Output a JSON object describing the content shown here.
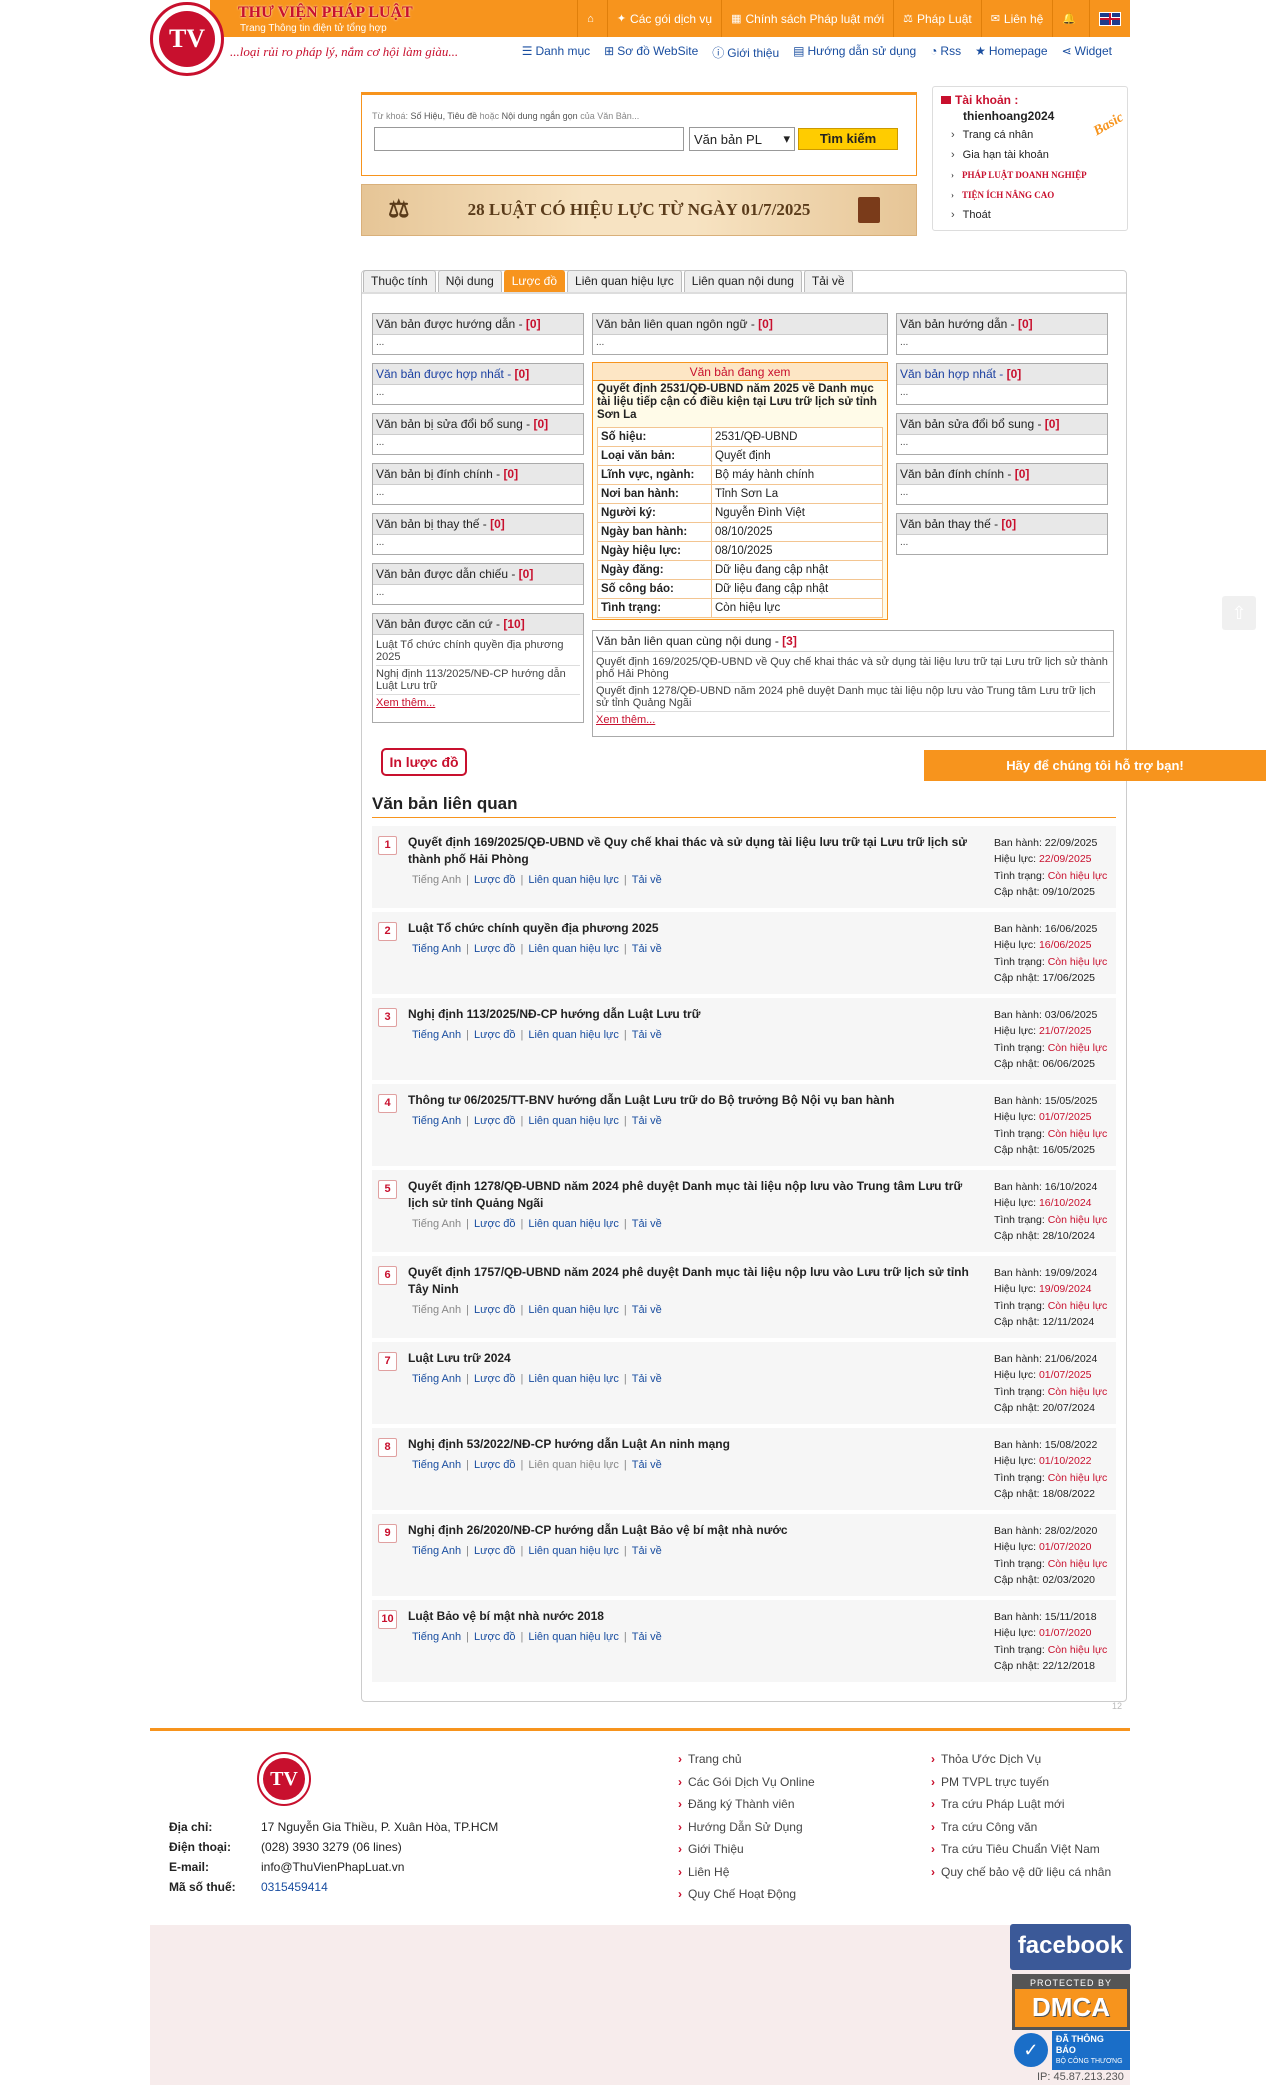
{
  "header": {
    "brand": "THƯ VIỆN PHÁP LUẬT",
    "brand_sub": "Trang Thông tin điện tử tổng hợp",
    "slogan": "...loại rủi ro pháp lý, nắm cơ hội làm giàu...",
    "logo_text": "TV",
    "topnav": [
      {
        "icon": "home-icon",
        "glyph": "⌂",
        "label": ""
      },
      {
        "icon": "gift-icon",
        "glyph": "✦",
        "label": "Các gói dịch vụ"
      },
      {
        "icon": "policy-icon",
        "glyph": "▦",
        "label": "Chính sách Pháp luật mới"
      },
      {
        "icon": "scale-icon",
        "glyph": "⚖",
        "label": "Pháp Luật"
      },
      {
        "icon": "mail-icon",
        "glyph": "✉",
        "label": "Liên hệ"
      },
      {
        "icon": "bell-icon",
        "glyph": "🔔",
        "label": ""
      },
      {
        "icon": "uk-flag-icon",
        "glyph": "",
        "label": ""
      }
    ],
    "subnav": [
      {
        "icon": "list-icon",
        "glyph": "☰",
        "label": "Danh mục"
      },
      {
        "icon": "sitemap-icon",
        "glyph": "⊞",
        "label": "Sơ đồ WebSite"
      },
      {
        "icon": "info-icon",
        "glyph": "ⓘ",
        "label": "Giới thiệu"
      },
      {
        "icon": "book-icon",
        "glyph": "▤",
        "label": "Hướng dẫn sử dụng"
      },
      {
        "icon": "rss-icon",
        "glyph": "◔",
        "label": "Rss"
      },
      {
        "icon": "star-icon",
        "glyph": "★",
        "label": "Homepage"
      },
      {
        "icon": "share-icon",
        "glyph": "⋖",
        "label": "Widget"
      }
    ]
  },
  "search": {
    "hint_prefix": "Từ khoá: ",
    "hint_b1": "Số Hiệu, Tiêu đề",
    "hint_mid": " hoặc ",
    "hint_b2": "Nội dung ngắn gọn",
    "hint_suffix": " của Văn Bản...",
    "value": "",
    "select_value": "Văn bản PL",
    "button": "Tìm kiếm"
  },
  "banner": {
    "text": "28 LUẬT CÓ HIỆU LỰC TỪ NGÀY 01/7/2025"
  },
  "account": {
    "title": "Tài khoản :",
    "username": "thienhoang2024",
    "badge": "Basic",
    "items": [
      "Trang cá nhân",
      "Gia hạn tài khoản"
    ],
    "red_items": [
      "PHÁP LUẬT DOANH NGHIỆP",
      "TIỆN ÍCH NÂNG CAO"
    ],
    "logout": "Thoát"
  },
  "tabs": [
    "Thuộc tính",
    "Nội dung",
    "Lược đồ",
    "Liên quan hiệu lực",
    "Liên quan nội dung",
    "Tải về"
  ],
  "diagram": {
    "left": [
      {
        "label": "Văn bản được hướng dẫn - ",
        "count": "[0]",
        "body": "..."
      },
      {
        "label": "Văn bản được hợp nhất - ",
        "count": "[0]",
        "body": "...",
        "blue": true
      },
      {
        "label": "Văn bản bị sửa đổi bổ sung - ",
        "count": "[0]",
        "body": "..."
      },
      {
        "label": "Văn bản bị đính chính - ",
        "count": "[0]",
        "body": "..."
      },
      {
        "label": "Văn bản bị thay thế - ",
        "count": "[0]",
        "body": "..."
      },
      {
        "label": "Văn bản được dẫn chiếu - ",
        "count": "[0]",
        "body": "..."
      }
    ],
    "can_cu": {
      "label": "Văn bản được căn cứ - ",
      "count": "[10]",
      "items": [
        "Luật Tổ chức chính quyền địa phương 2025",
        "Nghị định 113/2025/NĐ-CP hướng dẫn Luật Lưu trữ"
      ],
      "more": "Xem thêm..."
    },
    "ngon_ngu": {
      "label": "Văn bản liên quan ngôn ngữ - ",
      "count": "[0]",
      "body": "..."
    },
    "right": [
      {
        "label": "Văn bản hướng dẫn - ",
        "count": "[0]",
        "body": "..."
      },
      {
        "label": "Văn bản hợp nhất - ",
        "count": "[0]",
        "body": "...",
        "blue": true
      },
      {
        "label": "Văn bản sửa đổi bổ sung - ",
        "count": "[0]",
        "body": "..."
      },
      {
        "label": "Văn bản đính chính - ",
        "count": "[0]",
        "body": "..."
      },
      {
        "label": "Văn bản thay thế - ",
        "count": "[0]",
        "body": "..."
      }
    ],
    "current": {
      "header": "Văn bản đang xem",
      "title": "Quyết định 2531/QĐ-UBND năm 2025 về Danh mục tài liệu tiếp cận có điều kiện tại Lưu trữ lịch sử tỉnh Sơn La",
      "rows": [
        [
          "Số hiệu:",
          "2531/QĐ-UBND"
        ],
        [
          "Loại văn bản:",
          "Quyết định"
        ],
        [
          "Lĩnh vực, ngành:",
          "Bộ máy hành chính"
        ],
        [
          "Nơi ban hành:",
          "Tỉnh Sơn La"
        ],
        [
          "Người ký:",
          "Nguyễn Đình Việt"
        ],
        [
          "Ngày ban hành:",
          "08/10/2025"
        ],
        [
          "Ngày hiệu lực:",
          "08/10/2025"
        ],
        [
          "Ngày đăng:",
          "Dữ liệu đang cập nhật"
        ],
        [
          "Số công báo:",
          "Dữ liệu đang cập nhật"
        ],
        [
          "Tình trạng:",
          "Còn hiệu lực"
        ]
      ]
    },
    "cung_noi_dung": {
      "label": "Văn bản liên quan cùng nội dung - ",
      "count": "[3]",
      "items": [
        "Quyết định 169/2025/QĐ-UBND về Quy chế khai thác và sử dụng tài liệu lưu trữ tại Lưu trữ lịch sử thành phố Hải Phòng",
        "Quyết định 1278/QĐ-UBND năm 2024 phê duyệt Danh mục tài liệu nộp lưu vào Trung tâm Lưu trữ lịch sử tỉnh Quảng Ngãi"
      ],
      "more": "Xem thêm..."
    }
  },
  "print_button": "In lược đồ",
  "support_button": "Hãy để chúng tôi hỗ trợ bạn!",
  "related": {
    "title": "Văn bản liên quan",
    "meta_labels": {
      "issued": "Ban hành: ",
      "effective": "Hiệu lực: ",
      "status": "Tình trạng: ",
      "updated": "Cập nhật: "
    },
    "link_labels": [
      "Tiếng Anh",
      "Lược đồ",
      "Liên quan hiệu lực",
      "Tải về"
    ],
    "items": [
      {
        "n": "1",
        "title": "Quyết định 169/2025/QĐ-UBND về Quy chế khai thác và sử dụng tài liệu lưu trữ tại Lưu trữ lịch sử thành phố Hải Phòng",
        "issued": "22/09/2025",
        "effective": "22/09/2025",
        "status": "Còn hiệu lực",
        "updated": "09/10/2025",
        "en_disabled": true,
        "lqhl_disabled": false,
        "two_line": true
      },
      {
        "n": "2",
        "title": "Luật Tổ chức chính quyền địa phương 2025",
        "issued": "16/06/2025",
        "effective": "16/06/2025",
        "status": "Còn hiệu lực",
        "updated": "17/06/2025",
        "en_disabled": false,
        "lqhl_disabled": false,
        "two_line": false
      },
      {
        "n": "3",
        "title": "Nghị định 113/2025/NĐ-CP hướng dẫn Luật Lưu trữ",
        "issued": "03/06/2025",
        "effective": "21/07/2025",
        "status": "Còn hiệu lực",
        "updated": "06/06/2025",
        "en_disabled": false,
        "lqhl_disabled": false,
        "two_line": false
      },
      {
        "n": "4",
        "title": "Thông tư 06/2025/TT-BNV hướng dẫn Luật Lưu trữ do Bộ trưởng Bộ Nội vụ ban hành",
        "issued": "15/05/2025",
        "effective": "01/07/2025",
        "status": "Còn hiệu lực",
        "updated": "16/05/2025",
        "en_disabled": false,
        "lqhl_disabled": false,
        "two_line": false
      },
      {
        "n": "5",
        "title": "Quyết định 1278/QĐ-UBND năm 2024 phê duyệt Danh mục tài liệu nộp lưu vào Trung tâm Lưu trữ lịch sử tỉnh Quảng Ngãi",
        "issued": "16/10/2024",
        "effective": "16/10/2024",
        "status": "Còn hiệu lực",
        "updated": "28/10/2024",
        "en_disabled": true,
        "lqhl_disabled": false,
        "two_line": true
      },
      {
        "n": "6",
        "title": "Quyết định 1757/QĐ-UBND năm 2024 phê duyệt Danh mục tài liệu nộp lưu vào Lưu trữ lịch sử tỉnh Tây Ninh",
        "issued": "19/09/2024",
        "effective": "19/09/2024",
        "status": "Còn hiệu lực",
        "updated": "12/11/2024",
        "en_disabled": true,
        "lqhl_disabled": false,
        "two_line": true
      },
      {
        "n": "7",
        "title": "Luật Lưu trữ 2024",
        "issued": "21/06/2024",
        "effective": "01/07/2025",
        "status": "Còn hiệu lực",
        "updated": "20/07/2024",
        "en_disabled": false,
        "lqhl_disabled": false,
        "two_line": false
      },
      {
        "n": "8",
        "title": "Nghị định 53/2022/NĐ-CP hướng dẫn Luật An ninh mạng",
        "issued": "15/08/2022",
        "effective": "01/10/2022",
        "status": "Còn hiệu lực",
        "updated": "18/08/2022",
        "en_disabled": false,
        "lqhl_disabled": true,
        "two_line": false
      },
      {
        "n": "9",
        "title": "Nghị định 26/2020/NĐ-CP hướng dẫn Luật Bảo vệ bí mật nhà nước",
        "issued": "28/02/2020",
        "effective": "01/07/2020",
        "status": "Còn hiệu lực",
        "updated": "02/03/2020",
        "en_disabled": false,
        "lqhl_disabled": false,
        "two_line": false
      },
      {
        "n": "10",
        "title": "Luật Bảo vệ bí mật nhà nước 2018",
        "issued": "15/11/2018",
        "effective": "01/07/2020",
        "status": "Còn hiệu lực",
        "updated": "22/12/2018",
        "en_disabled": false,
        "lqhl_disabled": false,
        "two_line": false
      }
    ]
  },
  "page_marker": "12",
  "footer": {
    "logo_text": "TV",
    "info": [
      {
        "k": "Địa chỉ:",
        "v": "17 Nguyễn Gia Thiều, P. Xuân Hòa, TP.HCM"
      },
      {
        "k": "Điện thoại:",
        "v": "(028) 3930 3279 (06 lines)"
      },
      {
        "k": "E-mail:",
        "v": "info@ThuVienPhapLuat.vn"
      },
      {
        "k": "Mã số thuế:",
        "v": "0315459414",
        "blue": true
      }
    ],
    "col1": [
      "Trang chủ",
      "Các Gói Dịch Vụ Online",
      "Đăng ký Thành viên",
      "Hướng Dẫn Sử Dụng",
      "Giới Thiệu",
      "Liên Hệ",
      "Quy Chế Hoạt Động"
    ],
    "col2": [
      "Thỏa Ước Dịch Vụ",
      "PM TVPL trực tuyến",
      "Tra cứu Pháp Luật mới",
      "Tra cứu Công văn",
      "Tra cứu Tiêu Chuẩn Việt Nam",
      "Quy chế bảo vệ dữ liệu cá nhân"
    ],
    "facebook": "facebook",
    "dmca_top": "PROTECTED BY",
    "dmca": "DMCA",
    "bct": "ĐÃ THÔNG BÁO",
    "bct_sub": "BỘ CÔNG THƯƠNG",
    "ip": "IP: 45.87.213.230"
  }
}
